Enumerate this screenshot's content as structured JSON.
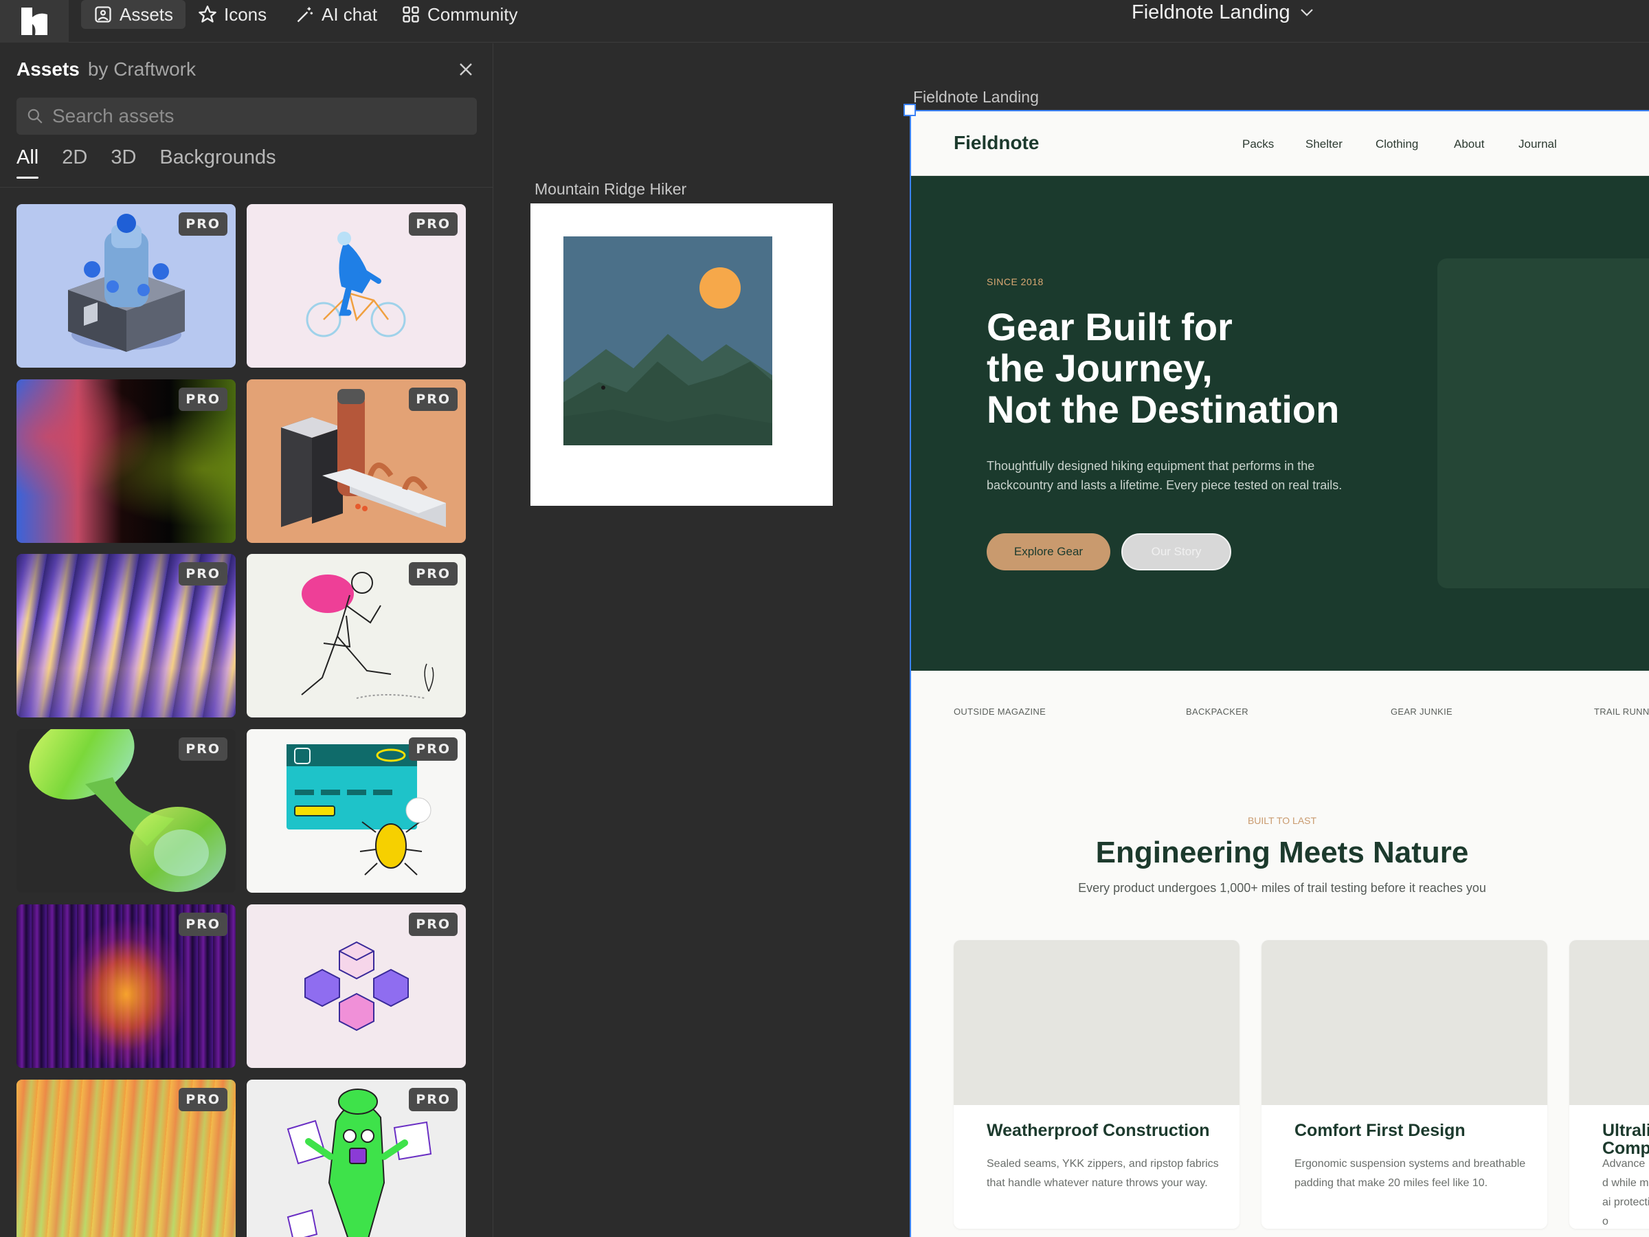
{
  "topbar": {
    "tabs": [
      {
        "label": "Assets",
        "icon": "image-icon"
      },
      {
        "label": "Icons",
        "icon": "star-icon"
      },
      {
        "label": "AI chat",
        "icon": "magic-wand-icon"
      },
      {
        "label": "Community",
        "icon": "grid-icon"
      }
    ],
    "document_title": "Fieldnote Landing"
  },
  "sidebar": {
    "title": "Assets",
    "subtitle": "by Craftwork",
    "search_placeholder": "Search assets",
    "filters": [
      "All",
      "2D",
      "3D",
      "Backgrounds"
    ],
    "active_filter": "All",
    "badge": "PRO",
    "cards": [
      {
        "theme": "3D isometric machine with spheres",
        "bg": "#b7c8f0"
      },
      {
        "theme": "Person riding bicycle",
        "bg": "#f4e8ef"
      },
      {
        "theme": "Blurred red-blue-green gradient",
        "bg": "#0a0a0a"
      },
      {
        "theme": "3D copper pipes lab",
        "bg": "#e3a275"
      },
      {
        "theme": "Purple wave gradient",
        "bg": "#5b3fa0"
      },
      {
        "theme": "Line art hiker with backpack",
        "bg": "#f1f2ec"
      },
      {
        "theme": "Green glass 3D shape",
        "bg": "#2a2a2a"
      },
      {
        "theme": "Credit card with bug",
        "bg": "#f7f7f5"
      },
      {
        "theme": "Fire stripe gradient",
        "bg": "#1d0b3a"
      },
      {
        "theme": "Isometric cubes",
        "bg": "#f3e9ee"
      },
      {
        "theme": "Orange green gradient",
        "bg": "#e8b060"
      },
      {
        "theme": "Green monster with papers",
        "bg": "#eeeeee"
      }
    ]
  },
  "canvas": {
    "hiker_frame_label": "Mountain Ridge Hiker",
    "site_frame_label": "Fieldnote Landing"
  },
  "site": {
    "brand": "Fieldnote",
    "nav": [
      "Packs",
      "Shelter",
      "Clothing",
      "About",
      "Journal"
    ],
    "hero": {
      "eyebrow": "SINCE 2018",
      "headline_1": "Gear Built for",
      "headline_2": "the Journey,",
      "headline_3": "Not the Destination",
      "sub": "Thoughtfully designed hiking equipment that performs in the backcountry and lasts a lifetime. Every piece tested on real trails.",
      "primary_cta": "Explore Gear",
      "secondary_cta": "Our Story"
    },
    "press": [
      "OUTSIDE MAGAZINE",
      "BACKPACKER",
      "GEAR JUNKIE",
      "TRAIL RUNNE"
    ],
    "section": {
      "eyebrow": "BUILT TO LAST",
      "title": "Engineering Meets Nature",
      "sub": "Every product undergoes 1,000+ miles of trail testing before it reaches you"
    },
    "features": [
      {
        "title": "Weatherproof Construction",
        "desc": "Sealed seams, YKK zippers, and ripstop fabrics that handle whatever nature throws your way."
      },
      {
        "title": "Comfort First Design",
        "desc": "Ergonomic suspension systems and breathable padding that make 20 miles feel like 10."
      },
      {
        "title": "Ultrali Comp",
        "desc": "Advanced while mai protectio"
      }
    ],
    "colors": {
      "forest": "#1b3a2d",
      "tan": "#c99a6e",
      "paper": "#fafaf8"
    }
  }
}
